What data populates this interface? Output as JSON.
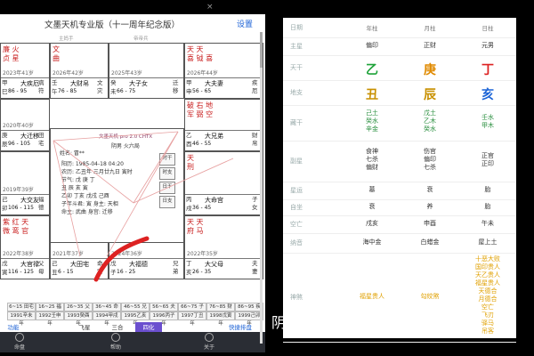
{
  "left_app": {
    "title": "文墨天机专业版（十一周年纪念版）",
    "settings_label": "设置",
    "close_icon": "×",
    "palaces": [
      {
        "top": "廉 火\n贞 星",
        "age": "2023年41岁",
        "gz": "甲\n巳",
        "name": "大疾厄",
        "range": "86 - 95",
        "star": "病\n符"
      },
      {
        "top": "文\n曲",
        "age": "2026年42岁",
        "gz": "壬\n午",
        "name": "大财帛",
        "range": "76 - 85",
        "star": "文\n灾"
      },
      {
        "top": "",
        "age": "2025年43岁",
        "gz": "癸\n未",
        "name": "大子女",
        "range": "66 - 75",
        "star": "迁\n移"
      },
      {
        "top": "天 天\n喜 钺 喜",
        "age": "2026年44岁",
        "gz": "甲\n申",
        "name": "大夫妻",
        "range": "56 - 65",
        "star": "疾\n厄"
      },
      {
        "top": "",
        "age": "2020年40岁",
        "gz": "庚\n辰",
        "name": "大迁移",
        "range": "96 - 105",
        "star": "田\n宅"
      },
      {
        "top": "破 右 地\n军 弼 空",
        "age": "",
        "gz": "乙\n酉",
        "name": "大兄弟",
        "range": "46 - 55",
        "star": "财\n帛"
      },
      {
        "top": "",
        "age": "2019年39岁",
        "gz": "己\n卯",
        "name": "大交友",
        "range": "106 - 115",
        "star": "福\n德"
      },
      {
        "top": "天\n刑",
        "age": "",
        "gz": "丙\n戌",
        "name": "大命宫",
        "range": "36 - 45",
        "star": "子\n女"
      },
      {
        "top": "紫 红 天\n微 鸾 官",
        "age": "2022年38岁",
        "gz": "戊\n寅",
        "name": "大官禄",
        "range": "116 - 125",
        "star": "父\n母"
      },
      {
        "top": "武 贪 地\n曲 狼 劫",
        "age": "2021年37岁",
        "gz": "己\n丑",
        "name": "大田宅",
        "range": "6 - 15",
        "star": "命\n宫"
      },
      {
        "top": "太 太 天 孙\n阳 阴 魁 喜",
        "age": "2024年36岁",
        "gz": "戊\n子",
        "name": "大福德",
        "range": "16 - 25",
        "star": "兄\n弟"
      },
      {
        "top": "天 天\n府 马",
        "age": "2022年35岁",
        "gz": "丁\n亥",
        "name": "大父母",
        "range": "26 - 35",
        "star": "夫\n妻"
      }
    ],
    "top_labels": [
      "主妈手",
      "帝帝兵"
    ],
    "bottom_labels": [
      "妃偏手",
      "小偏手"
    ],
    "center": {
      "brand": "文墨天机 pro 2.0  CHTX",
      "sub": "阴男  火六局",
      "name": "姓名: 冒**",
      "lines": [
        "阳历: 1985-04-18 04:20",
        "农历: 乙丑年 三月廿九日 寅时",
        "节气: 戊  庚  丁",
        "      丑  辰  亥  寅",
        "乙卯 丁亥 戊戌 己酉",
        "子年斗君: 寅  身主: 天相",
        "命主: 武曲  身宫: 迁移"
      ],
      "btns": [
        "时干",
        "时支",
        "日干",
        "日支"
      ]
    },
    "decades": [
      "6~15 田宅",
      "16~25 福德",
      "26~35 父母",
      "36~45 命宫",
      "46~55 兄弟",
      "56~65 夫妻",
      "66~75 子女",
      "76~85 财帛",
      "86~95 疾厄"
    ],
    "years": [
      "1991辛未年",
      "1992壬申年",
      "1993癸酉年",
      "1994甲戌年",
      "1995乙亥年",
      "1996丙子年",
      "1997丁丑年",
      "1998戊寅年",
      "1999己卯年"
    ],
    "tabs": [
      "功能",
      "飞星",
      "三合",
      "四化",
      "快捷排盘"
    ],
    "nav": [
      "命盘",
      "帮助",
      "关于"
    ]
  },
  "right_panel": {
    "headers": [
      "日期",
      "年柱",
      "月柱",
      "日柱"
    ],
    "rows": [
      {
        "label": "主星",
        "vals": [
          "偏印",
          "正财",
          "元男"
        ]
      },
      {
        "label": "天干",
        "vals": [
          "乙",
          "庚",
          "丁"
        ],
        "colors": [
          "#1fa33a",
          "#e08a00",
          "#d22"
        ]
      },
      {
        "label": "地支",
        "vals": [
          "丑",
          "辰",
          "亥"
        ],
        "colors": [
          "#c89000",
          "#c89000",
          "#1a63d6"
        ]
      },
      {
        "label": "藏干",
        "vals": [
          "己土\n癸水\n辛金",
          "戊土\n乙木\n癸水",
          "壬水\n甲木"
        ]
      },
      {
        "label": "副星",
        "vals": [
          "食神\n七杀\n偏财",
          "伤官\n偏印\n七杀",
          "正官\n正印"
        ]
      },
      {
        "label": "星运",
        "vals": [
          "墓",
          "衰",
          "胎"
        ]
      },
      {
        "label": "自坐",
        "vals": [
          "衰",
          "养",
          "胎"
        ]
      },
      {
        "label": "空亡",
        "vals": [
          "戌亥",
          "申酉",
          "午未"
        ]
      },
      {
        "label": "纳音",
        "vals": [
          "海中金",
          "白蜡金",
          "屋上土"
        ]
      },
      {
        "label": "神煞",
        "vals": [
          "福星贵人",
          "勾绞煞",
          "十恶大败\n国印贵人\n天乙贵人\n福星贵人\n天德合\n月德合\n空亡\n飞刃\n驿马\n吊客"
        ]
      }
    ]
  },
  "subtitle": "阴"
}
